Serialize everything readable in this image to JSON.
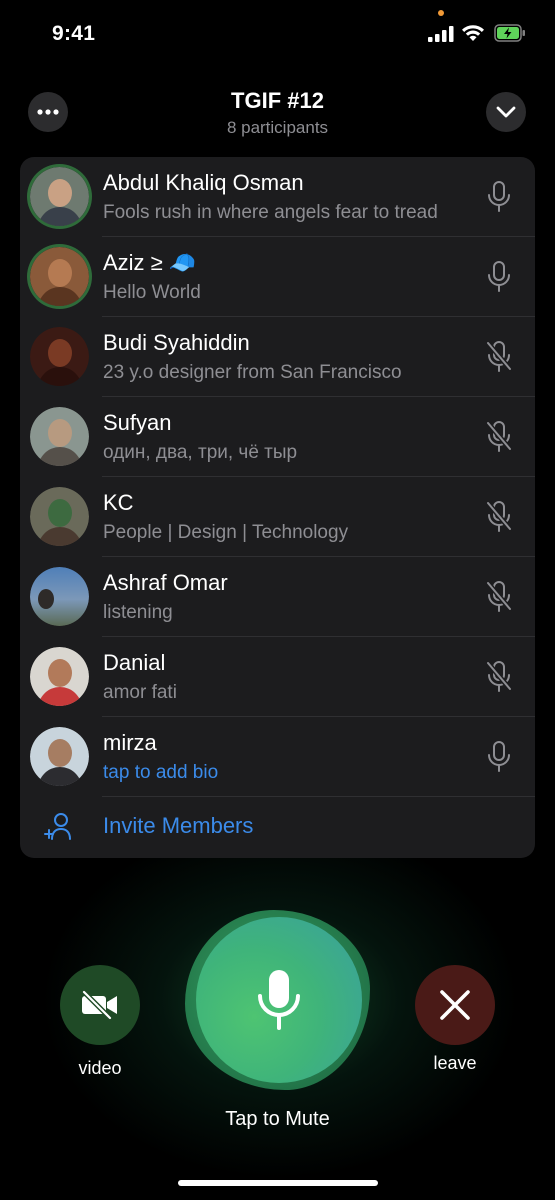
{
  "status": {
    "time": "9:41"
  },
  "header": {
    "title": "TGIF #12",
    "subtitle": "8 participants",
    "more_icon": "ellipsis-icon",
    "collapse_icon": "chevron-down-icon"
  },
  "participants": [
    {
      "name": "Abdul Khaliq Osman",
      "bio": "Fools rush in where angels fear to tread",
      "mic": "on",
      "speaking": true
    },
    {
      "name": "Aziz ≥ 🧢",
      "bio": "Hello World",
      "mic": "on",
      "speaking": true
    },
    {
      "name": "Budi Syahiddin",
      "bio": "23 y.o designer from San Francisco",
      "mic": "muted",
      "speaking": false
    },
    {
      "name": "Sufyan",
      "bio": "один, два, три, чё тыр",
      "mic": "muted",
      "speaking": false
    },
    {
      "name": "KC",
      "bio": "People | Design | Technology",
      "mic": "muted",
      "speaking": false
    },
    {
      "name": "Ashraf Omar",
      "bio": "listening",
      "mic": "muted",
      "speaking": false
    },
    {
      "name": "Danial",
      "bio": "amor fati",
      "mic": "muted",
      "speaking": false
    },
    {
      "name": "mirza",
      "bio": "tap to add bio",
      "mic": "on",
      "speaking": false
    }
  ],
  "invite": {
    "label": "Invite Members"
  },
  "controls": {
    "video_label": "video",
    "leave_label": "leave",
    "mute_label": "Tap to Mute"
  },
  "colors": {
    "accent_blue": "#3b8bea",
    "panel_bg": "#1c1c1e",
    "mute_green": "#3fb47a",
    "video_bg": "#1f4a26",
    "leave_bg": "#4a1a17"
  }
}
